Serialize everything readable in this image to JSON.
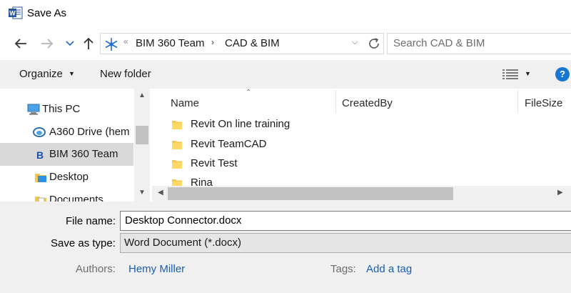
{
  "window": {
    "title": "Save As",
    "app_icon": "word-app-icon"
  },
  "nav": {
    "back_icon": "back-arrow-icon",
    "forward_icon": "forward-arrow-icon",
    "recent_icon": "chevron-down-icon",
    "up_icon": "up-arrow-icon"
  },
  "address": {
    "location_icon": "bim360-logo-icon",
    "separator": "«",
    "breadcrumbs": [
      "BIM 360 Team",
      "CAD & BIM"
    ],
    "breadcrumb_arrow": "›",
    "refresh_icon": "refresh-icon"
  },
  "search": {
    "placeholder": "Search CAD & BIM"
  },
  "toolbar": {
    "organize_label": "Organize",
    "new_folder_label": "New folder",
    "view_icon": "details-view-icon",
    "help_label": "?"
  },
  "navpane": {
    "items": [
      {
        "label": "This PC",
        "icon": "computer-icon",
        "selected": false
      },
      {
        "label": "A360 Drive (hem",
        "icon": "a360-drive-icon",
        "selected": false
      },
      {
        "label": "BIM 360 Team",
        "icon": "bim360-icon",
        "selected": true
      },
      {
        "label": "Desktop",
        "icon": "desktop-folder-icon",
        "selected": false
      },
      {
        "label": "Documents",
        "icon": "documents-folder-icon",
        "selected": false
      }
    ]
  },
  "filelist": {
    "columns": [
      "Name",
      "CreatedBy",
      "FileSize"
    ],
    "rows": [
      {
        "name": "Revit On line training",
        "icon": "folder-icon"
      },
      {
        "name": "Revit TeamCAD",
        "icon": "folder-icon"
      },
      {
        "name": "Revit Test",
        "icon": "folder-icon"
      },
      {
        "name": "Rina",
        "icon": "folder-icon"
      }
    ]
  },
  "form": {
    "file_name_label": "File name:",
    "file_name_value": "Desktop Connector.docx",
    "save_type_label": "Save as type:",
    "save_type_value": "Word Document (*.docx)",
    "authors_label": "Authors:",
    "authors_value": "Hemy Miller",
    "tags_label": "Tags:",
    "tags_value": "Add a tag"
  },
  "colors": {
    "accent": "#1877d2",
    "selection": "#d9d9d9",
    "folder": "#f7c94b",
    "link": "#1a5fb4",
    "toolbar_bg": "#f0f0f0"
  }
}
